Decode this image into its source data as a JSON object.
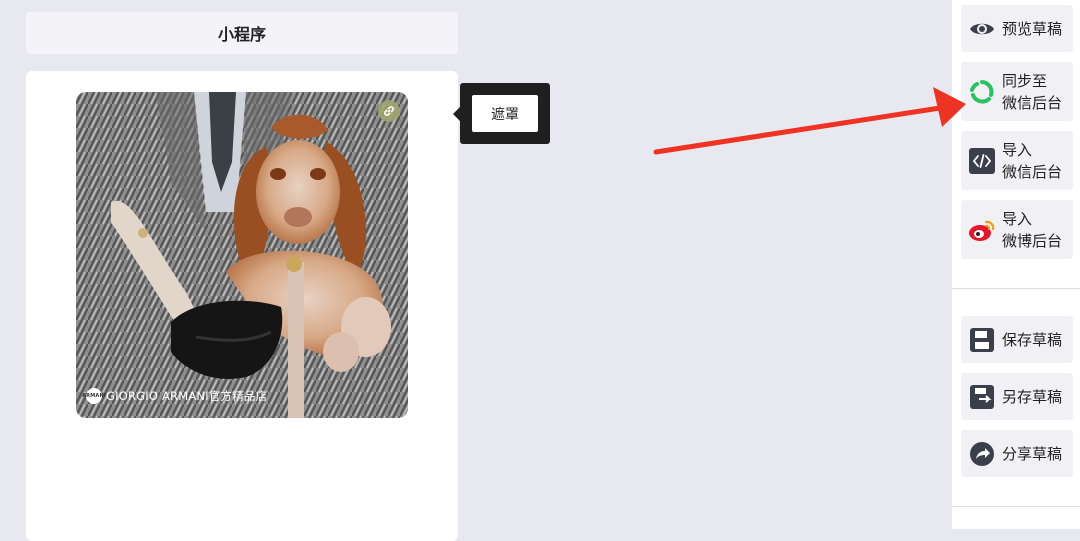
{
  "header": {
    "title": "小程序"
  },
  "preview_card": {
    "shop_name": "GIORGIO ARMANI官方精品店",
    "shop_logo_text": "ARMANI"
  },
  "mask_popup": {
    "button_label": "遮罩"
  },
  "sidebar": {
    "preview_label": "预览草稿",
    "sync_label_line1": "同步至",
    "sync_label_line2": "微信后台",
    "import_wechat_line1": "导入",
    "import_wechat_line2": "微信后台",
    "import_weibo_line1": "导入",
    "import_weibo_line2": "微博后台",
    "save_label": "保存草稿",
    "save_as_label": "另存草稿",
    "share_label": "分享草稿"
  },
  "colors": {
    "background": "#e8e8f1",
    "arrow": "#ee3322",
    "wechat_green": "#2ac261",
    "weibo_red": "#e6162d"
  },
  "icons": [
    "eye-icon",
    "wechat-sync-icon",
    "code-icon",
    "weibo-icon",
    "save-icon",
    "save-as-icon",
    "share-icon",
    "link-icon"
  ]
}
